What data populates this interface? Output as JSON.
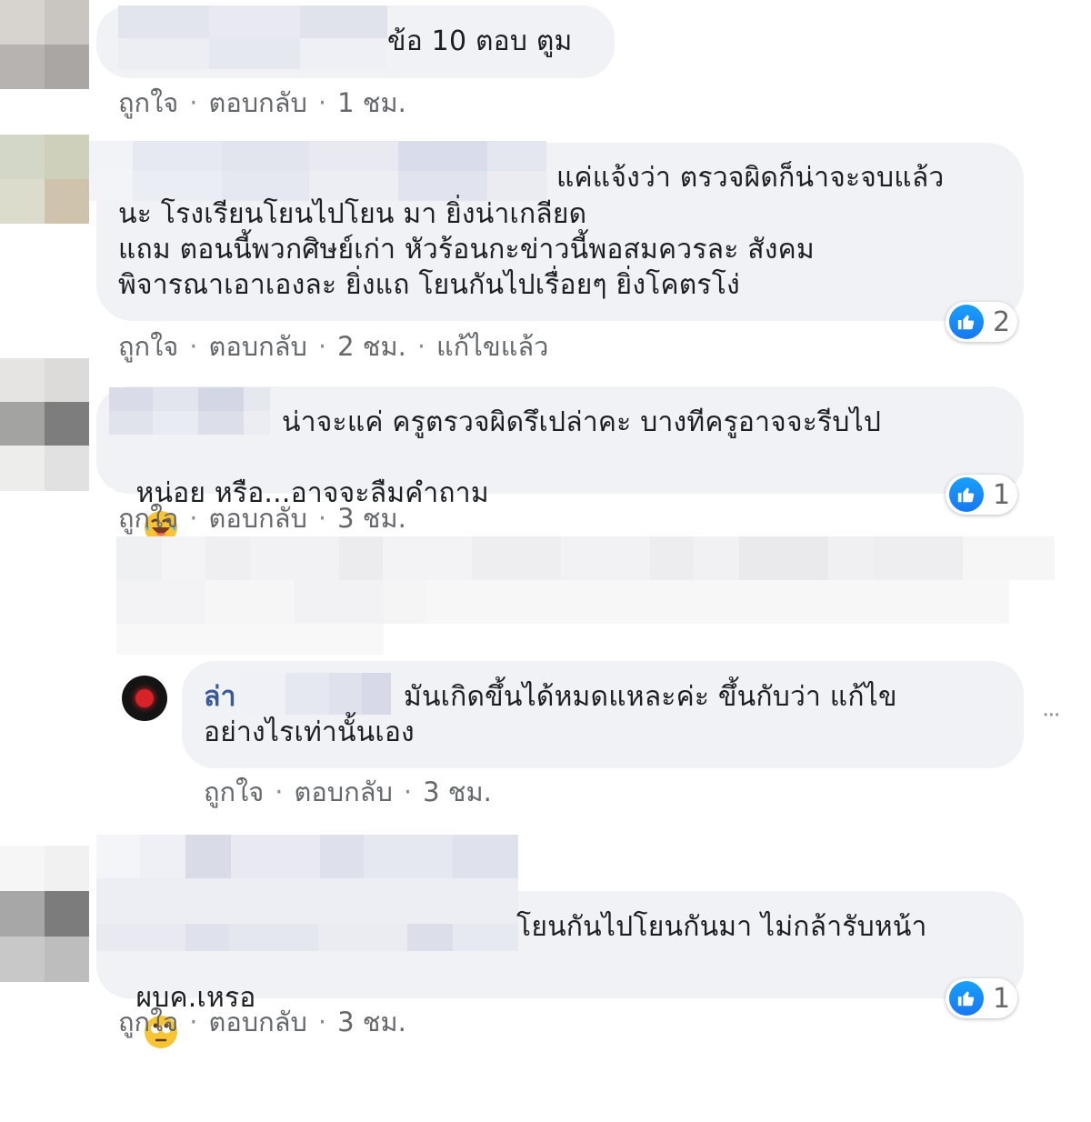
{
  "actions": {
    "like": "ถูกใจ",
    "reply": "ตอบกลับ",
    "separator": "·",
    "edited": "แก้ไขแล้ว"
  },
  "comments": [
    {
      "lines": [
        "ข้อ 10 ตอบ ตูม"
      ],
      "time": "1 ชม."
    },
    {
      "lines": [
        "แค่แจ้งว่า ตรวจผิดก็น่าจะจบแล้ว",
        "นะ โรงเรียนโยนไปโยน มา ยิ่งน่าเกลียด",
        "แถม ตอนนี้พวกศิษย์เก่า หัวร้อนกะข่าวนี้พอสมควรละ สังคม",
        "พิจารณาเอาเองละ ยิ่งแถ โยนกันไปเรื่อยๆ ยิ่งโคตรโง่"
      ],
      "time": "2 ชม.",
      "reaction_count": "2"
    },
    {
      "lines": [
        "น่าจะแค่ ครูตรวจผิดรึเปล่าคะ บางทีครูอาจจะรีบไป",
        "หน่อย หรือ...อาจจะลืมคำถาม"
      ],
      "time": "3 ชม.",
      "reaction_count": "1",
      "emoji": "laughing-tears"
    },
    {
      "name_prefix": "ล่า",
      "lines": [
        "มันเกิดขึ้นได้หมดแหละค่ะ ขึ้นกับว่า แก้ไข",
        "อย่างไรเท่านั้นเอง"
      ],
      "time": "3 ชม.",
      "more": "···"
    },
    {
      "lines": [
        "โยนกันไปโยนกันมา ไม่กล้ารับหน้า",
        "ผบค.เหรอ"
      ],
      "time": "3 ชม.",
      "reaction_count": "1",
      "emoji": "rolling-eyes"
    }
  ],
  "colors": {
    "bubble": "#f0f2f5",
    "text": "#1c1e21",
    "meta": "#65676b",
    "like_blue": "#1877f2"
  }
}
